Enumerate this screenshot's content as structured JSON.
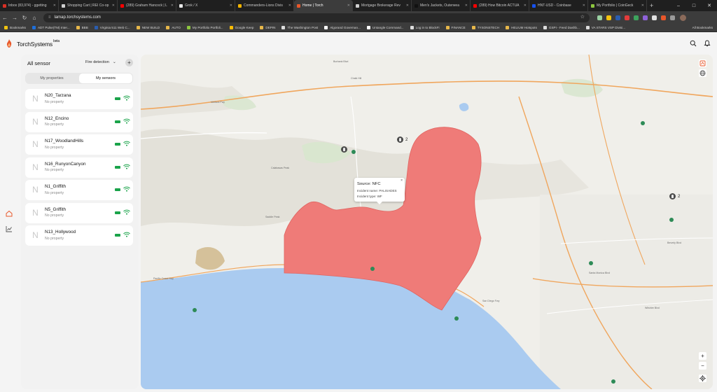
{
  "browser": {
    "tabs": [
      {
        "label": "Inbox (83,974) - ggetting",
        "color": "#d93025"
      },
      {
        "label": "Shopping Cart | REI Co-op",
        "color": "#cfcfcf"
      },
      {
        "label": "(289) Graham Hancock | L",
        "color": "#ff0000"
      },
      {
        "label": "Grok / X",
        "color": "#e8e8e8"
      },
      {
        "label": "Commanders-Lions Divis",
        "color": "#f4b400"
      },
      {
        "label": "Home | Torch",
        "color": "#e8572a"
      },
      {
        "label": "Mortgage Brokerage Rev",
        "color": "#cfcfcf"
      },
      {
        "label": "Men's Jackets, Outerwea",
        "color": "#111111"
      },
      {
        "label": "(289) How Bitcoin ACTUA",
        "color": "#ff0000"
      },
      {
        "label": "HNT-USD - Coinbase",
        "color": "#1652f0"
      },
      {
        "label": "My Portfolio | CoinGeck",
        "color": "#8dc63f"
      }
    ],
    "active_tab_index": 5,
    "new_tab": "+",
    "url": "lamap.torchsystems.com",
    "window_controls": [
      "–",
      "□",
      "✕"
    ],
    "bookmarks": [
      {
        "label": "Bookmarks",
        "color": "#f1c40f"
      },
      {
        "label": "ADT Pulse(TM) Inter...",
        "color": "#1e6fd9"
      },
      {
        "label": "BBB",
        "color": "#e8b84a"
      },
      {
        "label": "Virginia 511 Web C...",
        "color": "#2a5db0"
      },
      {
        "label": "NEW BUILD",
        "color": "#e8b84a"
      },
      {
        "label": "AUTO",
        "color": "#e8b84a"
      },
      {
        "label": "My Portfolio Portfoli...",
        "color": "#8dc63f"
      },
      {
        "label": "Google Keep",
        "color": "#fbbc04"
      },
      {
        "label": "DEPIN",
        "color": "#e8b84a"
      },
      {
        "label": "The Washington Post",
        "color": "#dddddd"
      },
      {
        "label": "Algorand Governan...",
        "color": "#ffffff"
      },
      {
        "label": "Untangle Command...",
        "color": "#ffffff"
      },
      {
        "label": "Log in to BlockFi",
        "color": "#dddddd"
      },
      {
        "label": "FINANCE",
        "color": "#e8b84a"
      },
      {
        "label": "TYSONSTECH",
        "color": "#e8b84a"
      },
      {
        "label": "HELIUM Hotspots",
        "color": "#e8b84a"
      },
      {
        "label": "GSPI - Feed Dashb...",
        "color": "#dddddd"
      },
      {
        "label": "VA STARS VSP Divisi...",
        "color": "#dddddd"
      }
    ],
    "all_bookmarks": "All Bookmarks"
  },
  "app": {
    "brand": "TorchSystems",
    "brand_tag": "beta",
    "accent": "#e8572a"
  },
  "panel": {
    "title": "All sensor",
    "filter": "Fire detection",
    "add": "+",
    "tabs": [
      "My properties",
      "My sensors"
    ],
    "active_tab": 1,
    "sensors": [
      {
        "badge": "N",
        "name": "N20_Tarzana",
        "property": "No property"
      },
      {
        "badge": "N",
        "name": "N12_Encino",
        "property": "No property"
      },
      {
        "badge": "N",
        "name": "N17_WoodlandHills",
        "property": "No property"
      },
      {
        "badge": "N",
        "name": "N16_RunyonCanyon",
        "property": "No property"
      },
      {
        "badge": "N",
        "name": "N1_Griffith",
        "property": "No property"
      },
      {
        "badge": "N",
        "name": "N5_Griffith",
        "property": "No property"
      },
      {
        "badge": "N",
        "name": "N13_Hollywood",
        "property": "No property"
      }
    ],
    "status_color": "#1aa34a"
  },
  "map": {
    "fire_color": "#ef7b78",
    "water_color": "#aacbf0",
    "clusters": [
      {
        "count": "2"
      },
      {
        "count": "2"
      }
    ],
    "popup": {
      "source": "Source: NFC",
      "incident_name": "Incident name: PALISADES",
      "incident_type": "Incident type: WF",
      "close": "×"
    },
    "zoom_in": "+",
    "zoom_out": "−",
    "labels": [
      {
        "text": "Burbank Blvd"
      },
      {
        "text": "Chalk Hill"
      },
      {
        "text": "Calabasas Peak"
      },
      {
        "text": "Saddle Peak"
      },
      {
        "text": "Pacific Coast Hwy"
      },
      {
        "text": "Beverly Blvd"
      },
      {
        "text": "Wilshire Blvd"
      },
      {
        "text": "Ventura Fwy"
      },
      {
        "text": "Santa Monica Blvd"
      },
      {
        "text": "San Diego Fwy"
      }
    ]
  }
}
